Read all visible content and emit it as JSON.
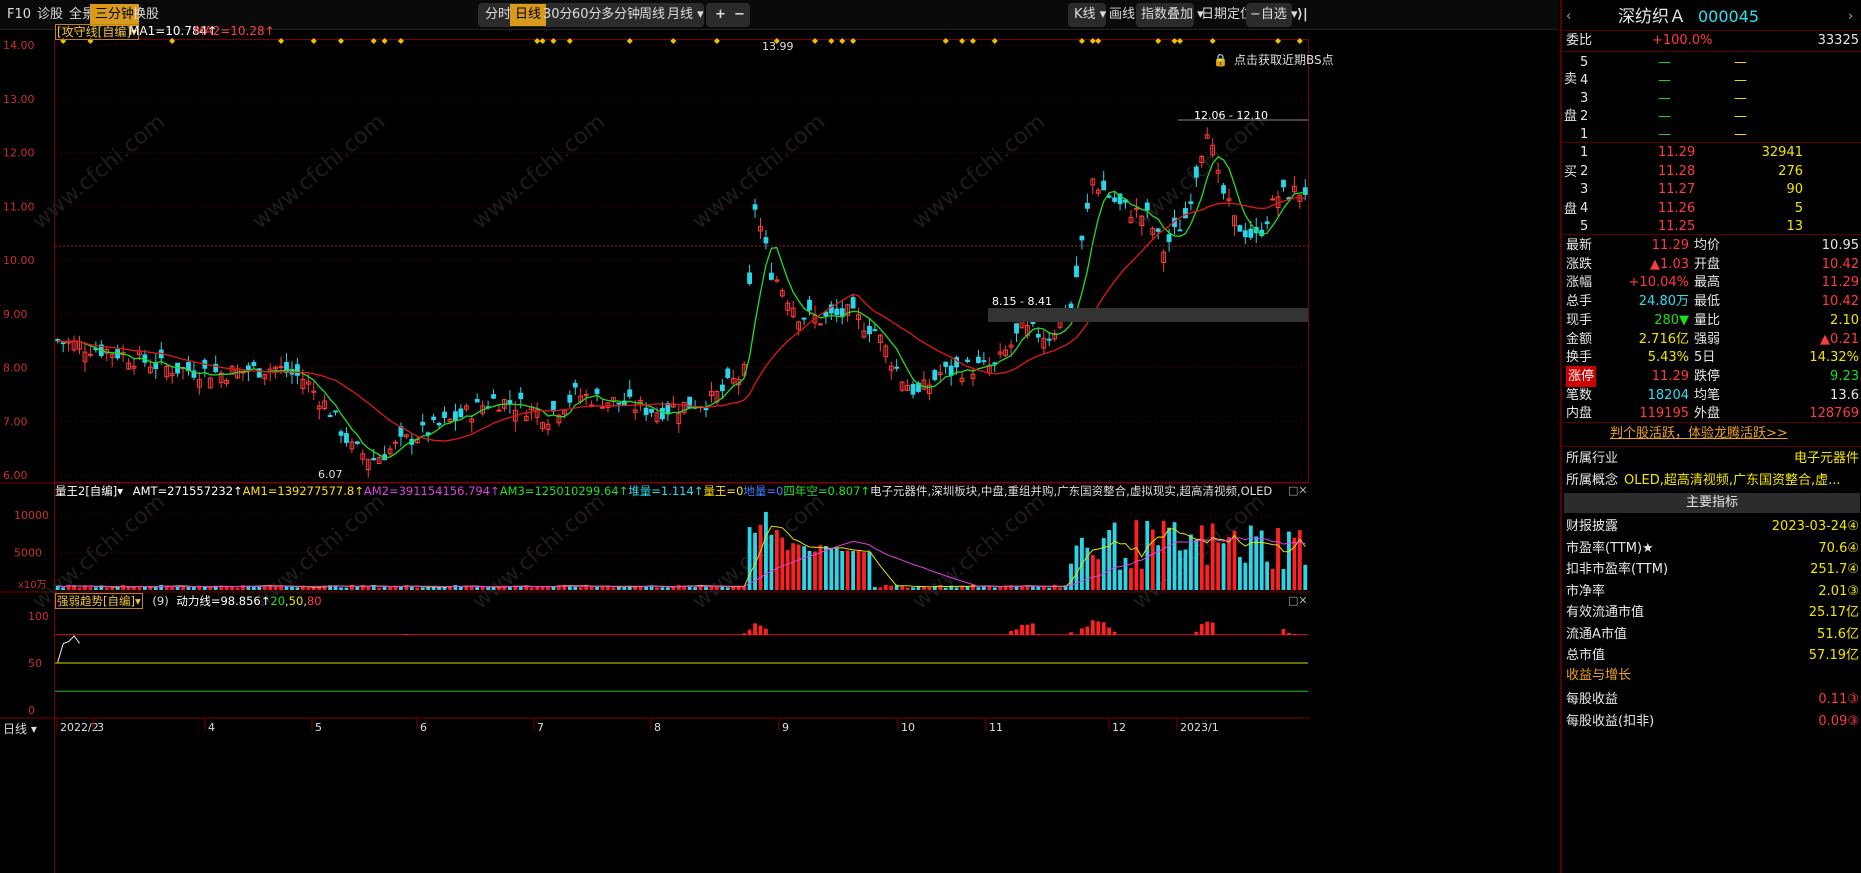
{
  "toolbar": {
    "left": [
      "F10",
      "诊股",
      "全景",
      "三分钟",
      "换股"
    ],
    "periods": [
      "分时",
      "日线",
      "30分",
      "60分",
      "多分钟",
      "周线",
      "月线 ▾"
    ],
    "zoom_in": "+",
    "zoom_out": "−",
    "right": [
      "K线 ▾",
      "画线",
      "指数叠加 ▾",
      "日期定位",
      "−自选 ▾"
    ]
  },
  "main_chart": {
    "indicator": "[攻守线[自编]▾",
    "ma1": "MA1=10.784↑",
    "ma2": "MA2=10.28↑",
    "y_ticks": [
      "14.00",
      "13.00",
      "12.00",
      "11.00",
      "10.00",
      "9.00",
      "8.00",
      "7.00",
      "6.00"
    ],
    "y_values": [
      14,
      13,
      12,
      11,
      10,
      9,
      8,
      7,
      6
    ],
    "high_label": "13.99",
    "low_label": "6.07",
    "range_label_1": "12.06 - 12.10",
    "range_label_2": "8.15 - 8.41",
    "bs_hint": "点击获取近期BS点",
    "watermark": "www.cfchi.com"
  },
  "volume_panel": {
    "title": "量王2[自编]▾",
    "amt": "AMT=271557232↑",
    "am1": "AM1=139277577.8↑",
    "am2": "AM2=391154156.794↑",
    "am3": "AM3=125010299.64↑",
    "dl": "堆量=1.114↑",
    "lw": "量王=0",
    "dx": "地量=0",
    "snk": "四年空=0.807↑",
    "tags": "电子元器件,深圳板块,中盘,重组并购,广东国资整合,虚拟现实,超高清视频,OLED",
    "y_ticks": [
      "10000",
      "5000"
    ],
    "unit": "x10万"
  },
  "trend_panel": {
    "title": "强弱趋势[自编]▾",
    "param": "(9)",
    "dl": "动力线=98.856↑",
    "l20": "20",
    "l50": "50",
    "l80": "80",
    "y_ticks": [
      "100",
      "50",
      "0"
    ]
  },
  "x_axis": {
    "label": "日线 ▾",
    "months": [
      "2022/2",
      "3",
      "4",
      "5",
      "6",
      "7",
      "8",
      "9",
      "10",
      "11",
      "12",
      "2023/1"
    ]
  },
  "stock": {
    "name": "深纺织Ａ",
    "code": "000045"
  },
  "order_book": {
    "ratio_label": "委比",
    "ratio": "+100.0%",
    "ratio_vol": "33325",
    "sell_side": "卖盘",
    "buy_side": "买盘",
    "sell": [
      {
        "lvl": "5",
        "p": "—",
        "v": "—"
      },
      {
        "lvl": "4",
        "p": "—",
        "v": "—"
      },
      {
        "lvl": "3",
        "p": "—",
        "v": "—"
      },
      {
        "lvl": "2",
        "p": "—",
        "v": "—"
      },
      {
        "lvl": "1",
        "p": "—",
        "v": "—"
      }
    ],
    "buy": [
      {
        "lvl": "1",
        "p": "11.29",
        "v": "32941"
      },
      {
        "lvl": "2",
        "p": "11.28",
        "v": "276"
      },
      {
        "lvl": "3",
        "p": "11.27",
        "v": "90"
      },
      {
        "lvl": "4",
        "p": "11.26",
        "v": "5"
      },
      {
        "lvl": "5",
        "p": "11.25",
        "v": "13"
      }
    ]
  },
  "quote": [
    {
      "l": "最新",
      "v": "11.29",
      "r": "均价",
      "rv": "10.95"
    },
    {
      "l": "涨跌",
      "v": "▲1.03",
      "r": "开盘",
      "rv": "10.42"
    },
    {
      "l": "涨幅",
      "v": "+10.04%",
      "r": "最高",
      "rv": "11.29"
    },
    {
      "l": "总手",
      "v": "24.80万",
      "r": "最低",
      "rv": "10.42"
    },
    {
      "l": "现手",
      "v": "280▼",
      "r": "量比",
      "rv": "2.10"
    },
    {
      "l": "金额",
      "v": "2.716亿",
      "r": "强弱",
      "rv": "▲0.21"
    },
    {
      "l": "换手",
      "v": "5.43%",
      "r": "5日",
      "rv": "14.32%"
    },
    {
      "l": "涨停",
      "v": "11.29",
      "r": "跌停",
      "rv": "9.23"
    },
    {
      "l": "笔数",
      "v": "18204",
      "r": "均笔",
      "rv": "13.6"
    },
    {
      "l": "内盘",
      "v": "119195",
      "r": "外盘",
      "rv": "128769"
    }
  ],
  "promo": "判个股活跃，体验龙腾活跃>>",
  "industry": {
    "label": "所属行业",
    "value": "电子元器件"
  },
  "concept": {
    "label": "所属概念",
    "value": "OLED,超高清视频,广东国资整合,虚..."
  },
  "metrics_header": "主要指标",
  "metrics": [
    {
      "l": "财报披露",
      "v": "2023-03-24④"
    },
    {
      "l": "市盈率(TTM)★",
      "v": "70.6④"
    },
    {
      "l": "扣非市盈率(TTM)",
      "v": "251.7④"
    },
    {
      "l": "市净率",
      "v": "2.01③"
    },
    {
      "l": "有效流通市值",
      "v": "25.17亿"
    },
    {
      "l": "流通A市值",
      "v": "51.6亿"
    },
    {
      "l": "总市值",
      "v": "57.19亿"
    }
  ],
  "growth_header": "收益与增长",
  "growth": [
    {
      "l": "每股收益",
      "v": "0.11③"
    },
    {
      "l": "每股收益(扣非)",
      "v": "0.09③"
    }
  ]
}
